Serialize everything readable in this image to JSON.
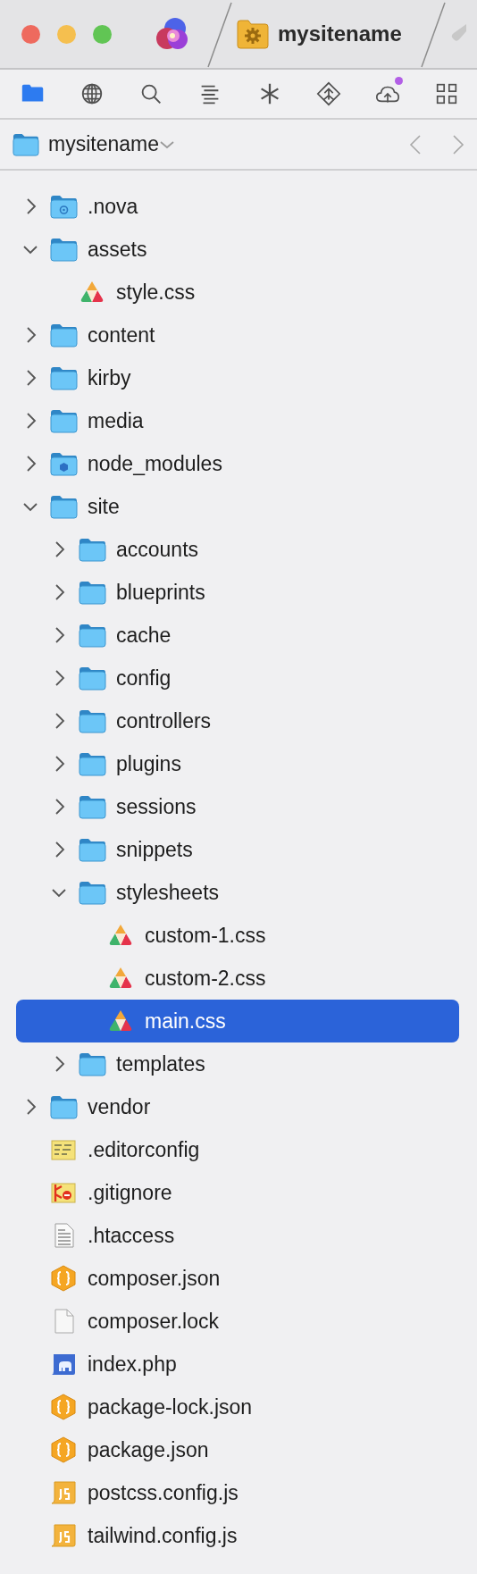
{
  "tab_bar": {
    "title": "mysitename"
  },
  "toolbar": [
    {
      "kind": "files",
      "selected": true,
      "badge": false
    },
    {
      "kind": "globe",
      "selected": false,
      "badge": false
    },
    {
      "kind": "search",
      "selected": false,
      "badge": false
    },
    {
      "kind": "symbols",
      "selected": false,
      "badge": false
    },
    {
      "kind": "clips",
      "selected": false,
      "badge": false
    },
    {
      "kind": "git",
      "selected": false,
      "badge": false
    },
    {
      "kind": "publish",
      "selected": false,
      "badge": true
    },
    {
      "kind": "extensions",
      "selected": false,
      "badge": false
    }
  ],
  "path_bar": {
    "title": "mysitename"
  },
  "tree": [
    {
      "name": ".nova",
      "kind": "nova-folder",
      "expanded": false,
      "selected": false
    },
    {
      "name": "assets",
      "kind": "folder",
      "expanded": true,
      "selected": false,
      "children": [
        {
          "name": "style.css",
          "kind": "css",
          "selected": false
        }
      ]
    },
    {
      "name": "content",
      "kind": "folder",
      "expanded": false,
      "selected": false
    },
    {
      "name": "kirby",
      "kind": "folder",
      "expanded": false,
      "selected": false
    },
    {
      "name": "media",
      "kind": "folder",
      "expanded": false,
      "selected": false
    },
    {
      "name": "node_modules",
      "kind": "node-folder",
      "expanded": false,
      "selected": false
    },
    {
      "name": "site",
      "kind": "folder",
      "expanded": true,
      "selected": false,
      "children": [
        {
          "name": "accounts",
          "kind": "folder",
          "expanded": false,
          "selected": false
        },
        {
          "name": "blueprints",
          "kind": "folder",
          "expanded": false,
          "selected": false
        },
        {
          "name": "cache",
          "kind": "folder",
          "expanded": false,
          "selected": false
        },
        {
          "name": "config",
          "kind": "folder",
          "expanded": false,
          "selected": false
        },
        {
          "name": "controllers",
          "kind": "folder",
          "expanded": false,
          "selected": false
        },
        {
          "name": "plugins",
          "kind": "folder",
          "expanded": false,
          "selected": false
        },
        {
          "name": "sessions",
          "kind": "folder",
          "expanded": false,
          "selected": false
        },
        {
          "name": "snippets",
          "kind": "folder",
          "expanded": false,
          "selected": false
        },
        {
          "name": "stylesheets",
          "kind": "folder",
          "expanded": true,
          "selected": false,
          "children": [
            {
              "name": "custom-1.css",
              "kind": "css",
              "selected": false
            },
            {
              "name": "custom-2.css",
              "kind": "css",
              "selected": false
            },
            {
              "name": "main.css",
              "kind": "css",
              "selected": true
            }
          ]
        },
        {
          "name": "templates",
          "kind": "folder",
          "expanded": false,
          "selected": false
        }
      ]
    },
    {
      "name": "vendor",
      "kind": "folder",
      "expanded": false,
      "selected": false
    },
    {
      "name": ".editorconfig",
      "kind": "config",
      "selected": false
    },
    {
      "name": ".gitignore",
      "kind": "git",
      "selected": false
    },
    {
      "name": ".htaccess",
      "kind": "text",
      "selected": false
    },
    {
      "name": "composer.json",
      "kind": "json",
      "selected": false
    },
    {
      "name": "composer.lock",
      "kind": "blank",
      "selected": false
    },
    {
      "name": "index.php",
      "kind": "php",
      "selected": false
    },
    {
      "name": "package-lock.json",
      "kind": "json",
      "selected": false
    },
    {
      "name": "package.json",
      "kind": "json",
      "selected": false
    },
    {
      "name": "postcss.config.js",
      "kind": "js",
      "selected": false
    },
    {
      "name": "tailwind.config.js",
      "kind": "js",
      "selected": false
    }
  ]
}
